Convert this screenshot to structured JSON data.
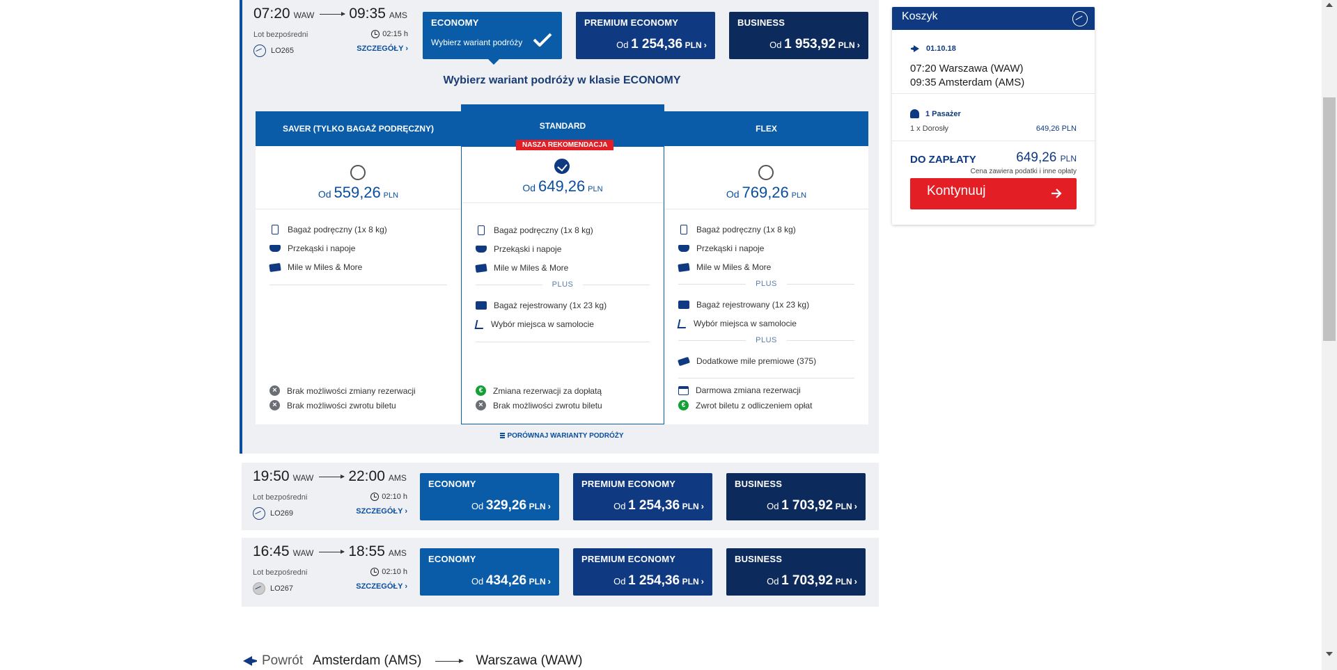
{
  "flights": [
    {
      "dep_time": "07:20",
      "dep_airport": "WAW",
      "arr_time": "09:35",
      "arr_airport": "AMS",
      "type": "Lot bezpośredni",
      "duration": "02:15 h",
      "flight_no": "LO265",
      "details": "SZCZEGÓŁY ›",
      "fares": {
        "economy": {
          "name": "ECONOMY",
          "sub": "Wybierz wariant podróży"
        },
        "premium": {
          "name": "PREMIUM ECONOMY",
          "prefix": "Od",
          "amount": "1 254,36",
          "currency": "PLN",
          "chevron": "›"
        },
        "business": {
          "name": "BUSINESS",
          "prefix": "Od",
          "amount": "1 953,92",
          "currency": "PLN",
          "chevron": "›"
        }
      }
    },
    {
      "dep_time": "19:50",
      "dep_airport": "WAW",
      "arr_time": "22:00",
      "arr_airport": "AMS",
      "type": "Lot bezpośredni",
      "duration": "02:10 h",
      "flight_no": "LO269",
      "details": "SZCZEGÓŁY ›",
      "fares": {
        "economy": {
          "name": "ECONOMY",
          "prefix": "Od",
          "amount": "329,26",
          "currency": "PLN",
          "chevron": "›"
        },
        "premium": {
          "name": "PREMIUM ECONOMY",
          "prefix": "Od",
          "amount": "1 254,36",
          "currency": "PLN",
          "chevron": "›"
        },
        "business": {
          "name": "BUSINESS",
          "prefix": "Od",
          "amount": "1 703,92",
          "currency": "PLN",
          "chevron": "›"
        }
      }
    },
    {
      "dep_time": "16:45",
      "dep_airport": "WAW",
      "arr_time": "18:55",
      "arr_airport": "AMS",
      "type": "Lot bezpośredni",
      "duration": "02:10 h",
      "flight_no": "LO267",
      "details": "SZCZEGÓŁY ›",
      "fares": {
        "economy": {
          "name": "ECONOMY",
          "prefix": "Od",
          "amount": "434,26",
          "currency": "PLN",
          "chevron": "›"
        },
        "premium": {
          "name": "PREMIUM ECONOMY",
          "prefix": "Od",
          "amount": "1 254,36",
          "currency": "PLN",
          "chevron": "›"
        },
        "business": {
          "name": "BUSINESS",
          "prefix": "Od",
          "amount": "1 703,92",
          "currency": "PLN",
          "chevron": "›"
        }
      }
    }
  ],
  "variant_section": {
    "title": "Wybierz wariant podróży w klasie ECONOMY",
    "compare_label": "PORÓWNAJ WARIANTY PODRÓŻY",
    "plus_label": "PLUS",
    "variants": [
      {
        "name": "SAVER (TYLKO BAGAŻ PODRĘCZNY)",
        "prefix": "Od",
        "amount": "559,26",
        "currency": "PLN",
        "selected": false,
        "features": [
          "Bagaż podręczny (1x 8 kg)",
          "Przekąski i napoje",
          "Mile w Miles & More"
        ],
        "conditions": [
          "Brak możliwości zmiany rezerwacji",
          "Brak możliwości zwrotu biletu"
        ]
      },
      {
        "name": "STANDARD",
        "badge": "NASZA REKOMENDACJA",
        "prefix": "Od",
        "amount": "649,26",
        "currency": "PLN",
        "selected": true,
        "features": [
          "Bagaż podręczny (1x 8 kg)",
          "Przekąski i napoje",
          "Mile w Miles & More"
        ],
        "plus_features": [
          "Bagaż rejestrowany (1x 23 kg)",
          "Wybór miejsca w samolocie"
        ],
        "conditions": [
          "Zmiana rezerwacji za dopłatą",
          "Brak możliwości zwrotu biletu"
        ]
      },
      {
        "name": "FLEX",
        "prefix": "Od",
        "amount": "769,26",
        "currency": "PLN",
        "selected": false,
        "features": [
          "Bagaż podręczny (1x 8 kg)",
          "Przekąski i napoje",
          "Mile w Miles & More"
        ],
        "plus_features": [
          "Bagaż rejestrowany (1x 23 kg)",
          "Wybór miejsca w samolocie"
        ],
        "plus_features_2": [
          "Dodatkowe mile premiowe (375)"
        ],
        "conditions": [
          "Darmowa zmiana rezerwacji",
          "Zwrot biletu z odliczeniem opłat"
        ]
      }
    ]
  },
  "return_header": {
    "label": "Powrót",
    "from": "Amsterdam (AMS)",
    "to": "Warszawa (WAW)"
  },
  "cart": {
    "title": "Koszyk",
    "date": "01.10.18",
    "dep_line": "07:20 Warszawa (WAW)",
    "arr_line": "09:35 Amsterdam (AMS)",
    "passengers": "1 Pasażer",
    "adult_label": "1 x Dorosły",
    "adult_price": "649,26 PLN",
    "pay_label": "DO ZAPŁATY",
    "pay_amount": "649,26",
    "pay_currency": "PLN",
    "pay_note": "Cena zawiera podatki i inne opłaty",
    "continue_label": "Kontynuuj"
  },
  "colors": {
    "economy": "#0a5ca8",
    "premium": "#0f3980",
    "business": "#0c2b5c",
    "accent_red": "#e31e24",
    "ok_green": "#12a037",
    "neutral_grey": "#6b6f75"
  }
}
